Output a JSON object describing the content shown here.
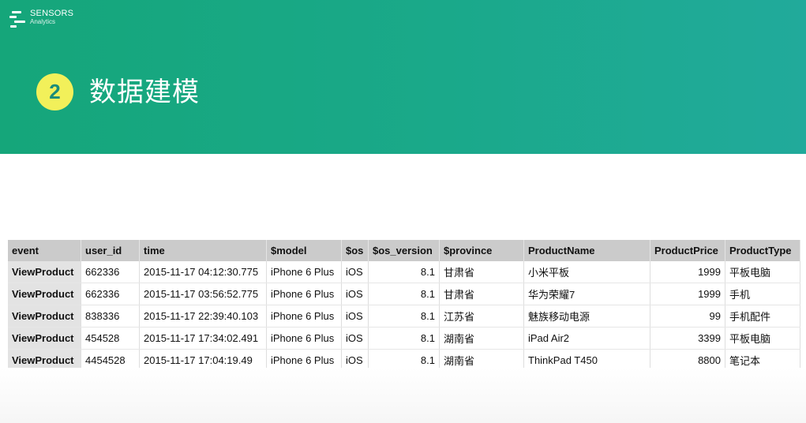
{
  "brand": {
    "name": "SENSORS",
    "sub": "Analytics"
  },
  "section": {
    "number": "2",
    "title": "数据建模"
  },
  "table": {
    "headers": [
      "event",
      "user_id",
      "time",
      "$model",
      "$os",
      "$os_version",
      "$province",
      "ProductName",
      "ProductPrice",
      "ProductType"
    ],
    "rows": [
      [
        "ViewProduct",
        "662336",
        "2015-11-17 04:12:30.775",
        "iPhone 6 Plus",
        "iOS",
        "8.1",
        "甘肃省",
        "小米平板",
        "1999",
        "平板电脑"
      ],
      [
        "ViewProduct",
        "662336",
        "2015-11-17 03:56:52.775",
        "iPhone 6 Plus",
        "iOS",
        "8.1",
        "甘肃省",
        "华为荣耀7",
        "1999",
        "手机"
      ],
      [
        "ViewProduct",
        "838336",
        "2015-11-17 22:39:40.103",
        "iPhone 6 Plus",
        "iOS",
        "8.1",
        "江苏省",
        "魅族移动电源",
        "99",
        "手机配件"
      ],
      [
        "ViewProduct",
        "454528",
        "2015-11-17 17:34:02.491",
        "iPhone 6 Plus",
        "iOS",
        "8.1",
        "湖南省",
        "iPad Air2",
        "3399",
        "平板电脑"
      ],
      [
        "ViewProduct",
        "4454528",
        "2015-11-17 17:04:19.49",
        "iPhone 6 Plus",
        "iOS",
        "8.1",
        "湖南省",
        "ThinkPad T450",
        "8800",
        "笔记本"
      ]
    ]
  },
  "colors": {
    "banner": "#1aa98a",
    "badge": "#f2f05a",
    "header_cell": "#cbcbcb"
  }
}
